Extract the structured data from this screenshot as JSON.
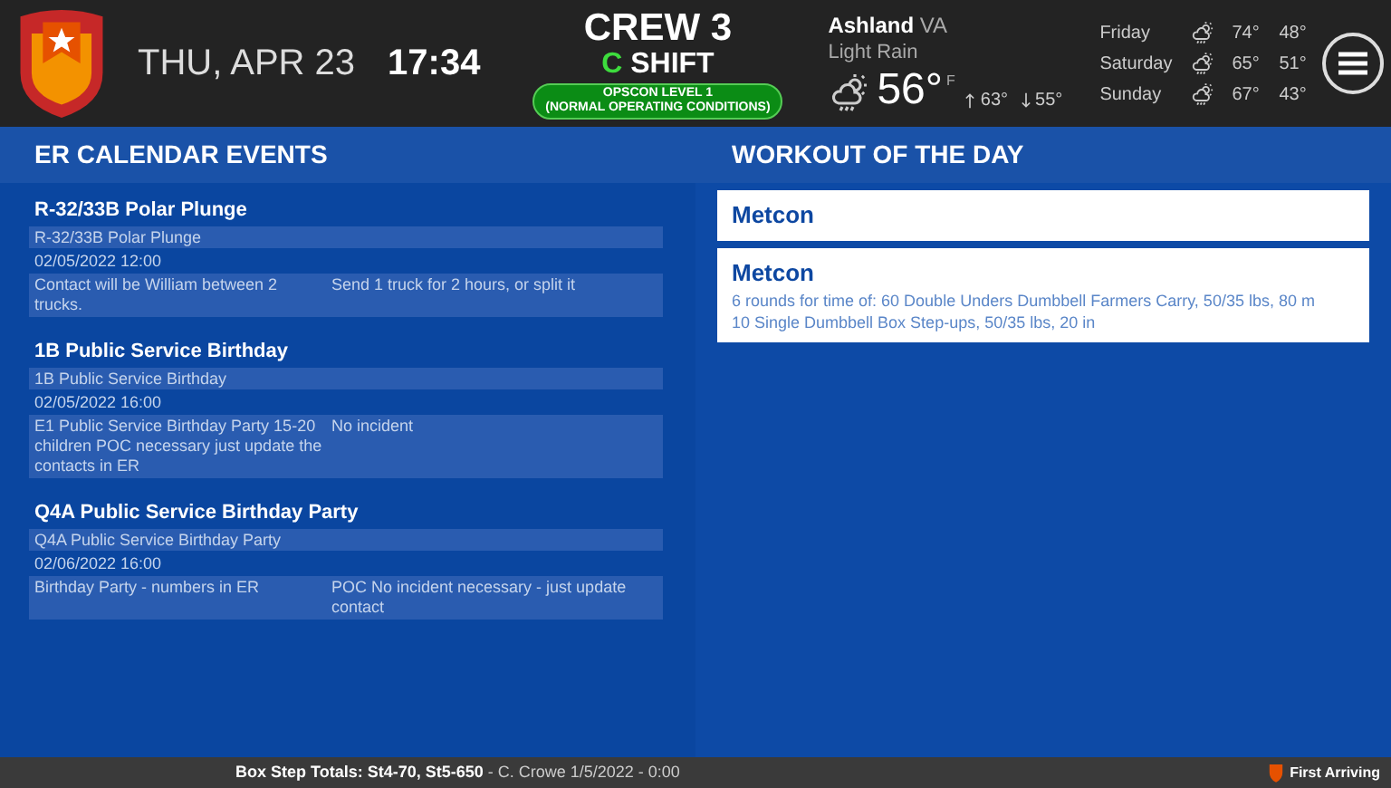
{
  "header": {
    "date": "THU, APR 23",
    "time": "17:34",
    "crew": "CREW 3",
    "shift_letter": "C",
    "shift_word": "SHIFT",
    "opscon_line1": "OPSCON LEVEL 1",
    "opscon_line2": "(NORMAL OPERATING CONDITIONS)"
  },
  "weather": {
    "city": "Ashland",
    "state": "VA",
    "condition": "Light Rain",
    "temp": "56°",
    "unit": "F",
    "high": "63°",
    "low": "55°",
    "forecast": [
      {
        "day": "Friday",
        "high": "74°",
        "low": "48°"
      },
      {
        "day": "Saturday",
        "high": "65°",
        "low": "51°"
      },
      {
        "day": "Sunday",
        "high": "67°",
        "low": "43°"
      }
    ]
  },
  "calendar": {
    "title": "ER CALENDAR EVENTS",
    "events": [
      {
        "title": "R-32/33B Polar Plunge",
        "name": "R-32/33B Polar Plunge",
        "datetime": "02/05/2022 12:00",
        "note_left": "Contact will be William between 2 trucks.",
        "note_right": "Send 1 truck for 2 hours, or split it"
      },
      {
        "title": "1B Public Service Birthday",
        "name": "1B Public Service Birthday",
        "datetime": "02/05/2022 16:00",
        "note_left": "E1 Public Service Birthday Party 15-20 children POC necessary just update the contacts in ER",
        "note_right": "No incident"
      },
      {
        "title": "Q4A Public Service Birthday Party",
        "name": "Q4A Public Service Birthday Party",
        "datetime": "02/06/2022 16:00",
        "note_left": "Birthday Party - numbers in ER",
        "note_right": "POC No incident necessary - just update contact"
      }
    ]
  },
  "workout": {
    "title": "WORKOUT OF THE DAY",
    "cards": [
      {
        "title": "Metcon"
      },
      {
        "title": "Metcon",
        "lines": [
          "6 rounds for time of: 60 Double Unders Dumbbell Farmers Carry, 50/35 lbs, 80 m",
          "10 Single Dumbbell Box Step-ups, 50/35 lbs, 20 in"
        ]
      }
    ]
  },
  "status_bar": {
    "text": "**Box Step Totals: St4-70, St5-650** - C. Crowe 1/5/2022 - 0:00",
    "brand": "First Arriving"
  }
}
